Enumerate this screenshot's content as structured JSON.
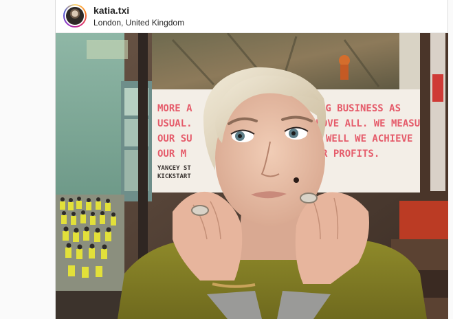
{
  "post": {
    "username": "katia.txi",
    "location": "London, United Kingdom"
  },
  "photo": {
    "poster_lines": [
      "MORE A",
      "NG BUSINESS AS",
      "USUAL.",
      "ABOVE ALL. WE MEASURE",
      "OUR SU",
      "WELL WE ACHIEVE",
      "OUR M",
      "R PROFITS.",
      "YANCEY ST",
      "KICKSTART"
    ]
  },
  "icons": {
    "avatar": "profile-avatar"
  }
}
